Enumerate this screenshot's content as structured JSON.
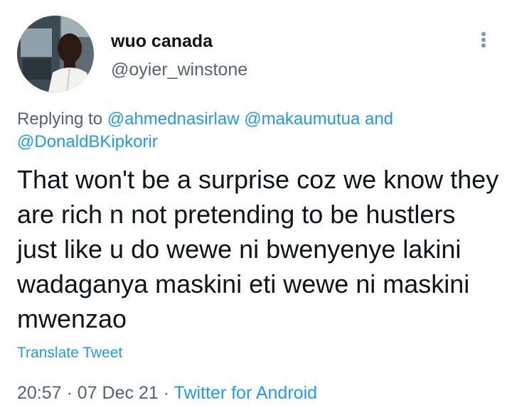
{
  "author": {
    "display_name": "wuo canada",
    "handle": "@oyier_winstone"
  },
  "reply": {
    "prefix": "Replying to",
    "mentions": [
      "@ahmednasirlaw",
      "@makaumutua",
      "@DonaldBKipkorir"
    ],
    "conjunction": "and"
  },
  "tweet": {
    "text": "That won't be a surprise coz we know they are rich n not pretending to be hustlers just like u do wewe ni bwenyenye lakini wadaganya maskini eti wewe ni maskini mwenzao"
  },
  "actions": {
    "translate_label": "Translate Tweet",
    "more_icon": "more-vertical-icon"
  },
  "meta": {
    "time": "20:57",
    "separator": "·",
    "date": "07 Dec 21",
    "source": "Twitter for Android"
  },
  "colors": {
    "link": "#1d9bf0",
    "secondary_text": "#536471",
    "primary_text": "#0f1419"
  }
}
